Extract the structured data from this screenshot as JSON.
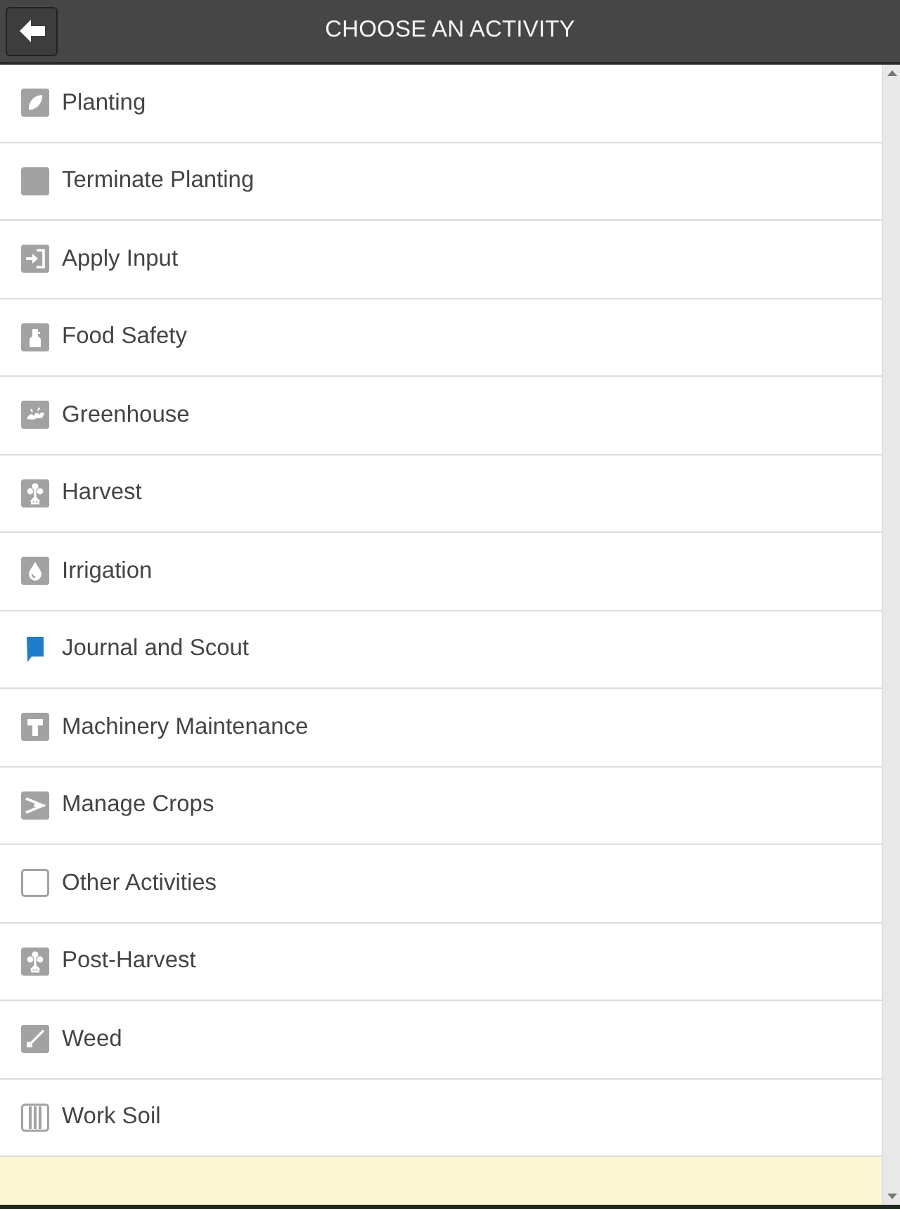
{
  "header": {
    "title": "CHOOSE AN ACTIVITY"
  },
  "activities": [
    {
      "label": "Planting",
      "kind": "seed"
    },
    {
      "label": "Terminate Planting",
      "kind": "block"
    },
    {
      "label": "Apply Input",
      "kind": "enter"
    },
    {
      "label": "Food Safety",
      "kind": "bottle"
    },
    {
      "label": "Greenhouse",
      "kind": "seedlings"
    },
    {
      "label": "Harvest",
      "kind": "plant"
    },
    {
      "label": "Irrigation",
      "kind": "drop"
    },
    {
      "label": "Journal and Scout",
      "kind": "bookmark"
    },
    {
      "label": "Machinery Maintenance",
      "kind": "hammer"
    },
    {
      "label": "Manage Crops",
      "kind": "shears"
    },
    {
      "label": "Other Activities",
      "kind": "outline"
    },
    {
      "label": "Post-Harvest",
      "kind": "plant"
    },
    {
      "label": "Weed",
      "kind": "hoe"
    },
    {
      "label": "Work Soil",
      "kind": "columns"
    }
  ]
}
